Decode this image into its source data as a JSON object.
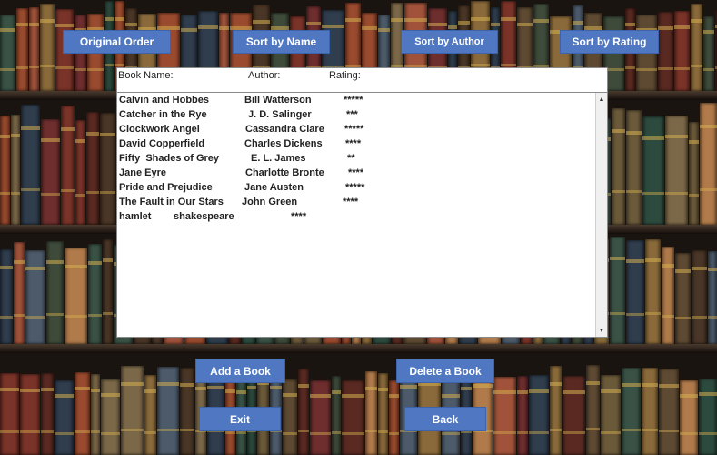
{
  "buttons": {
    "original_order": "Original Order",
    "sort_name": "Sort by Name",
    "sort_author": "Sort by Author",
    "sort_rating": "Sort by Rating",
    "add_book": "Add a Book",
    "delete_book": "Delete a Book",
    "exit": "Exit",
    "back": "Back"
  },
  "list": {
    "headers": {
      "name": "Book Name:",
      "author": "Author:",
      "rating": "Rating:"
    },
    "rows": [
      {
        "name": "Calvin and Hobbes",
        "author": "Bill Watterson",
        "rating": "*****"
      },
      {
        "name": "Catcher in the Rye",
        "author": "J. D. Salinger",
        "rating": "***"
      },
      {
        "name": "Clockwork Angel",
        "author": "Cassandra Clare",
        "rating": "*****"
      },
      {
        "name": "David Copperfield",
        "author": "Charles Dickens",
        "rating": "****"
      },
      {
        "name": "Fifty  Shades of Grey",
        "author": "E. L. James",
        "rating": "**"
      },
      {
        "name": "Jane Eyre",
        "author": "Charlotte Bronte",
        "rating": "****"
      },
      {
        "name": "Pride and Prejudice",
        "author": "Jane Austen",
        "rating": "*****"
      },
      {
        "name": "The Fault in Our Stars",
        "author": "John Green",
        "rating": "****"
      },
      {
        "name": "hamlet",
        "author": "shakespeare",
        "rating": "****"
      }
    ]
  },
  "colors": {
    "button_bg": "#4f77c2",
    "button_text": "#ffffff",
    "panel_bg": "#ffffff"
  },
  "icons": {
    "scroll_up": "triangle-up-icon",
    "scroll_down": "triangle-down-icon"
  }
}
